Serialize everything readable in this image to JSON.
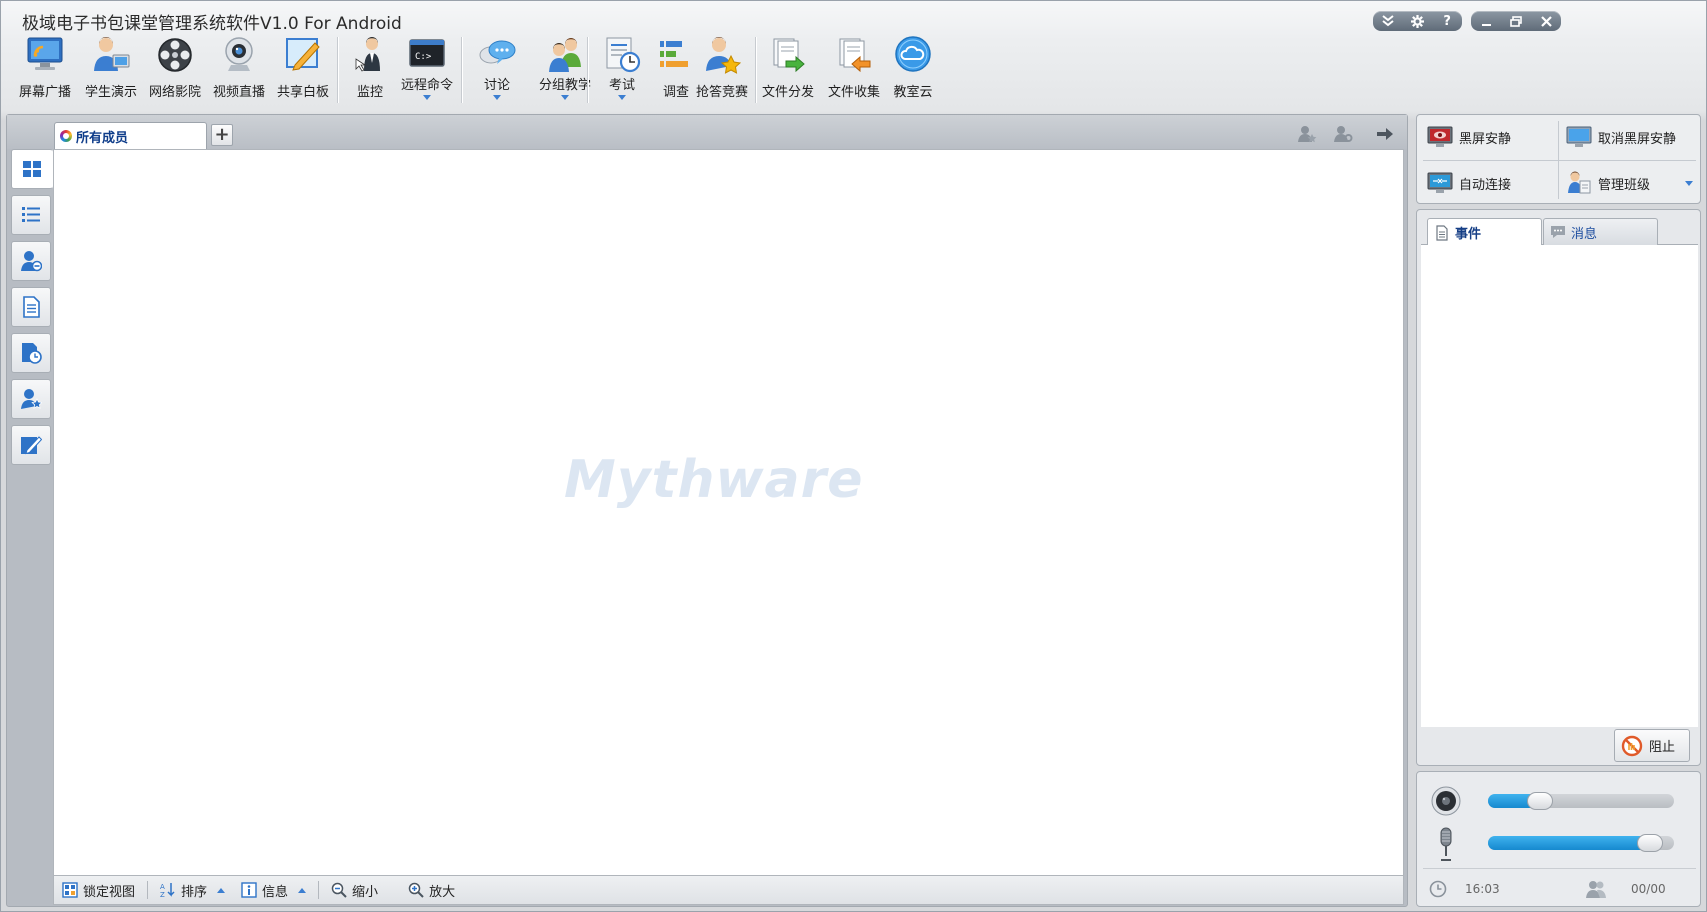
{
  "window": {
    "title": "极域电子书包课堂管理系统软件V1.0 For Android",
    "sys_buttons": [
      "collapse",
      "settings",
      "help",
      "minimize",
      "restore",
      "close"
    ]
  },
  "toolbar": {
    "items": [
      {
        "id": "screen-broadcast",
        "label": "屏幕广播",
        "icon": "broadcast-icon",
        "dropdown": false
      },
      {
        "id": "student-demo",
        "label": "学生演示",
        "icon": "student-demo-icon",
        "dropdown": false
      },
      {
        "id": "network-cinema",
        "label": "网络影院",
        "icon": "film-reel-icon",
        "dropdown": false
      },
      {
        "id": "video-live",
        "label": "视频直播",
        "icon": "webcam-icon",
        "dropdown": false
      },
      {
        "id": "shared-whiteboard",
        "label": "共享白板",
        "icon": "whiteboard-icon",
        "dropdown": false
      },
      {
        "id": "monitor",
        "label": "监控",
        "icon": "monitor-person-icon",
        "dropdown": false
      },
      {
        "id": "remote-command",
        "label": "远程命令",
        "icon": "command-prompt-icon",
        "dropdown": true
      },
      {
        "id": "discussion",
        "label": "讨论",
        "icon": "chat-bubbles-icon",
        "dropdown": true
      },
      {
        "id": "group-teaching",
        "label": "分组教学",
        "icon": "group-people-icon",
        "dropdown": true
      },
      {
        "id": "exam",
        "label": "考试",
        "icon": "exam-clock-icon",
        "dropdown": true
      },
      {
        "id": "survey",
        "label": "调查",
        "icon": "survey-bars-icon",
        "dropdown": false
      },
      {
        "id": "quiz-race",
        "label": "抢答竞赛",
        "icon": "person-star-icon",
        "dropdown": false
      },
      {
        "id": "file-distribute",
        "label": "文件分发",
        "icon": "file-send-icon",
        "dropdown": false
      },
      {
        "id": "file-collect",
        "label": "文件收集",
        "icon": "file-collect-icon",
        "dropdown": false
      },
      {
        "id": "classroom-cloud",
        "label": "教室云",
        "icon": "cloud-icon",
        "dropdown": false
      }
    ]
  },
  "tabs": {
    "active_label": "所有成员",
    "add_label": "+"
  },
  "sidebar": {
    "items": [
      {
        "id": "thumbnail-view",
        "icon": "grid-view-icon",
        "active": true
      },
      {
        "id": "list-view",
        "icon": "list-view-icon",
        "active": false
      },
      {
        "id": "member-status",
        "icon": "user-minus-icon",
        "active": false
      },
      {
        "id": "report-view",
        "icon": "document-icon",
        "active": false
      },
      {
        "id": "history-view",
        "icon": "document-clock-icon",
        "active": false
      },
      {
        "id": "favorite-view",
        "icon": "user-star-icon",
        "active": false
      },
      {
        "id": "edit-view",
        "icon": "pen-edit-icon",
        "active": false
      }
    ]
  },
  "workspace": {
    "watermark": "Mythware"
  },
  "statusbar": {
    "lock_view": "锁定视图",
    "sort": "排序",
    "info": "信息",
    "zoom_out": "缩小",
    "zoom_in": "放大"
  },
  "right_panel": {
    "black_screen": "黑屏安静",
    "cancel_black_screen": "取消黑屏安静",
    "auto_connect": "自动连接",
    "manage_class": "管理班级",
    "tab_events": "事件",
    "tab_messages": "消息",
    "block_button": "阻止",
    "speaker_volume": 0.28,
    "mic_volume": 0.87,
    "time": "16:03",
    "online_count": "00/00"
  },
  "colors": {
    "accent": "#1689cf",
    "tab_text": "#0f3d8a"
  }
}
